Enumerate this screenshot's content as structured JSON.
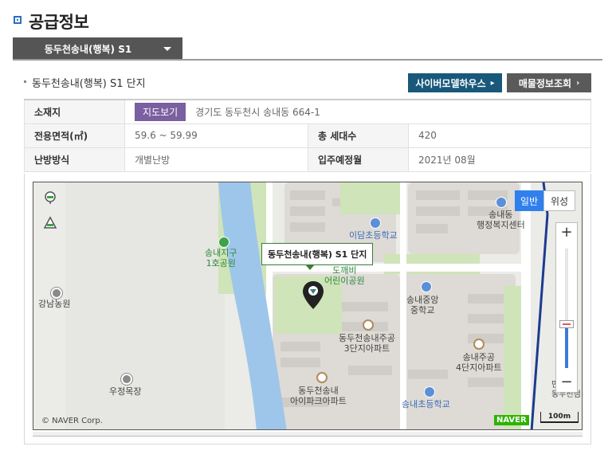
{
  "section": {
    "title": "공급정보"
  },
  "dropdown": {
    "selected": "동두천송내(행복) S1"
  },
  "complex": {
    "title": "동두천송내(행복) S1 단지"
  },
  "buttons": {
    "cyber_model_house": "사이버모델하우스",
    "listing_lookup": "매물정보조회"
  },
  "info": {
    "location_label": "소재지",
    "map_view_button": "지도보기",
    "location_value": "경기도 동두천시 송내동 664-1",
    "area_label": "전용면적(㎡)",
    "area_value": "59.6 ~ 59.99",
    "households_label": "총 세대수",
    "households_value": "420",
    "heating_label": "난방방식",
    "heating_value": "개별난방",
    "move_in_label": "입주예정월",
    "move_in_value": "2021년 08월"
  },
  "map": {
    "callout": "동두천송내(행복) S1 단지",
    "type_normal": "일반",
    "type_satellite": "위성",
    "copyright": "© NAVER Corp.",
    "naver_logo": "NAVER",
    "scale": "100m",
    "labels": {
      "park": "송내지구\n1호공원",
      "daycare": "도깨비\n어린이공원",
      "idam_school": "이담초등학교",
      "welfare": "송내동\n행정복지센터",
      "middle_school": "송내중앙\n중학교",
      "apt3": "동두천송내주공\n3단지아파트",
      "apt4": "송내주공\n4단지아파트",
      "aipark": "동두천송내\n아이파크아파트",
      "songnae_school": "송내초등학교",
      "farm": "강남농원",
      "ranch": "우정목장",
      "road_right": "동두천점",
      "edge_right": "민"
    }
  },
  "colors": {
    "accent_blue": "#2f6cc2",
    "cyber_button": "#18587a",
    "map_view_button": "#7b5fa0",
    "river": "#9ec6ea",
    "park": "#cfe4b8"
  }
}
